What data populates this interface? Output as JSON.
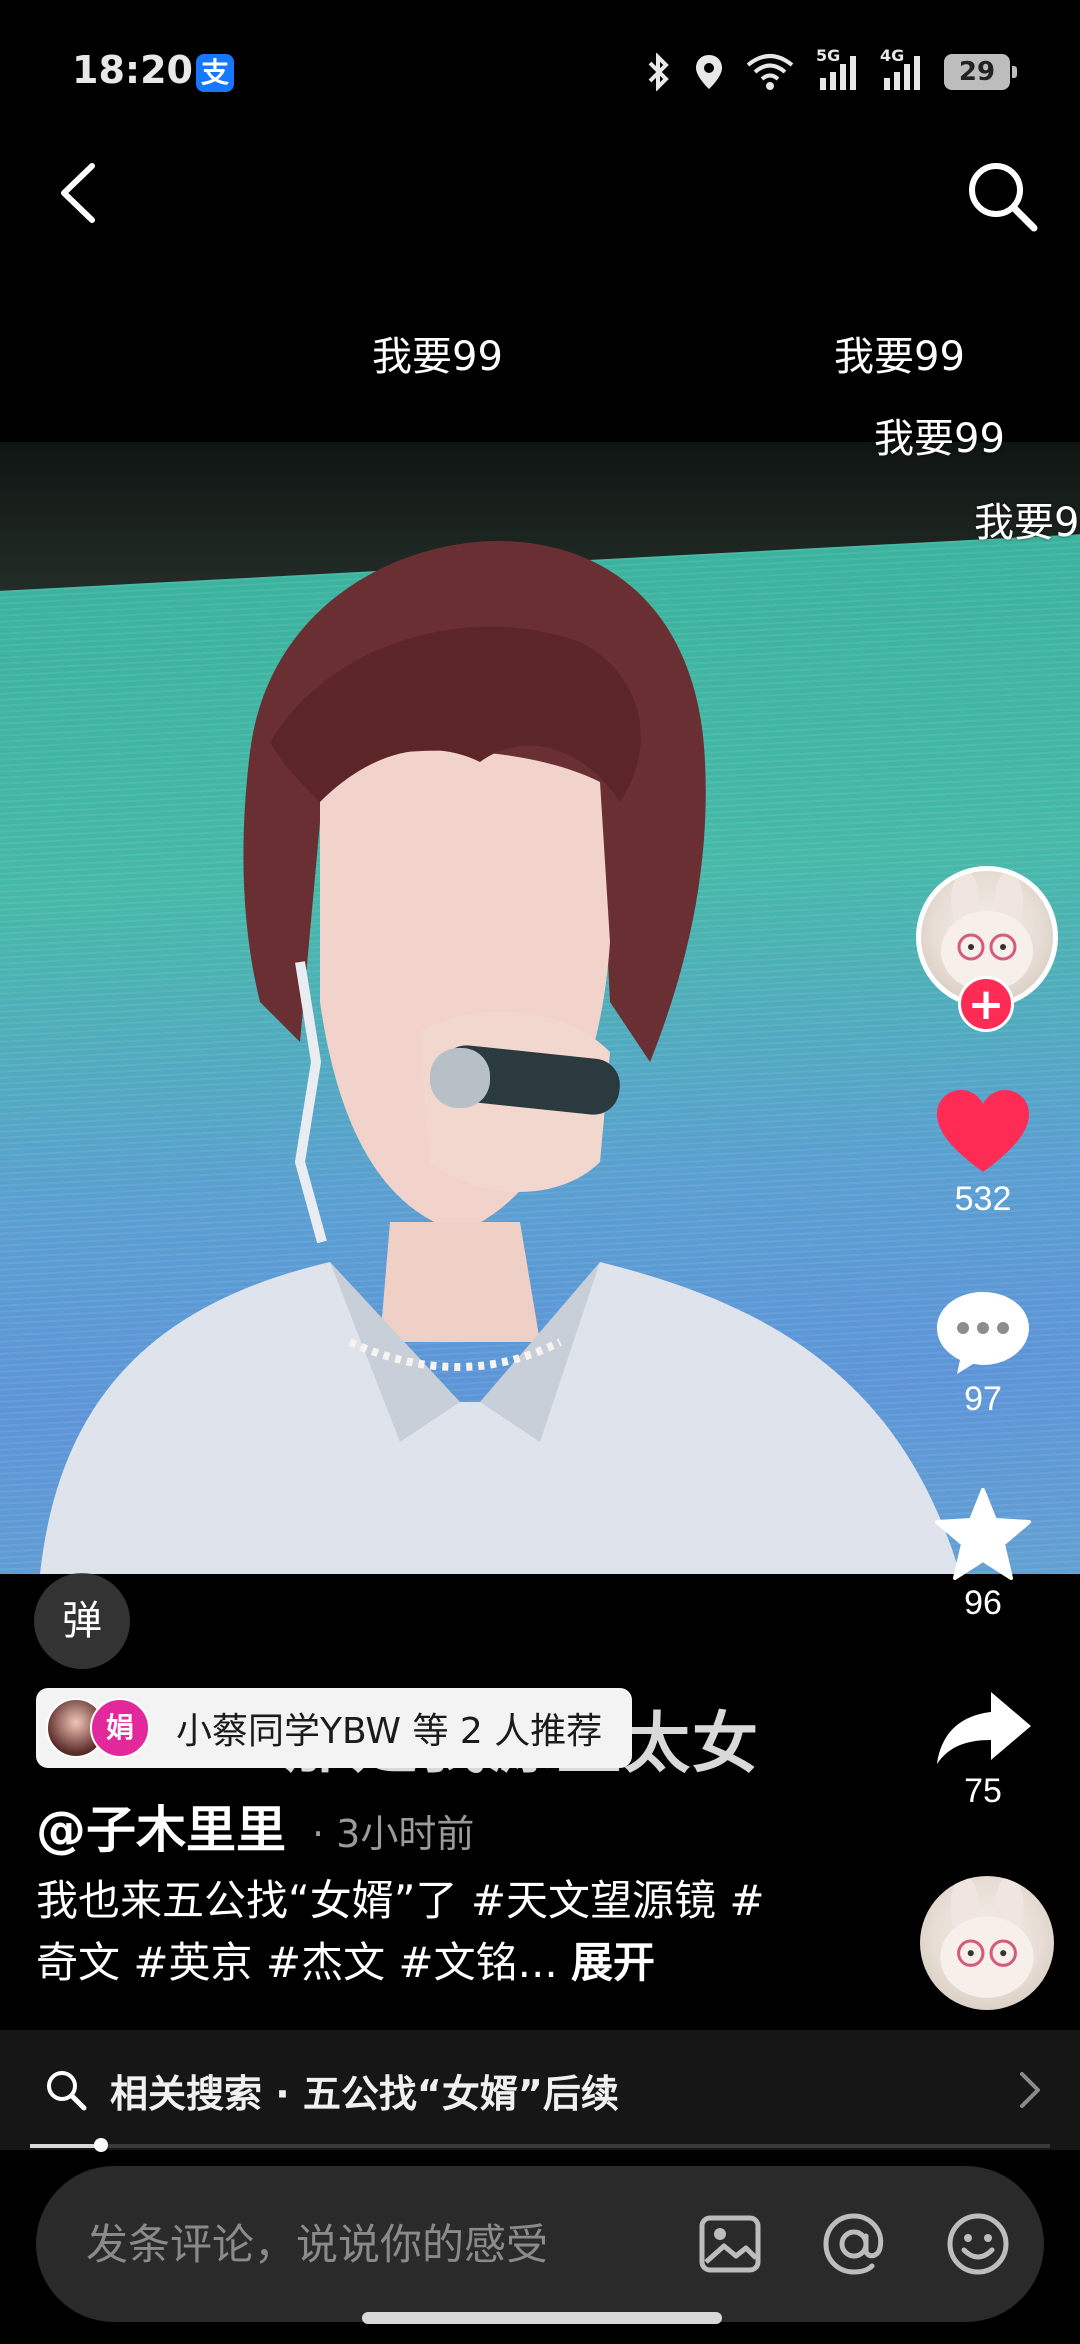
{
  "status_bar": {
    "time": "18:20",
    "app_icon": "alipay-icon",
    "app_icon_label": "支",
    "network_1": "5G",
    "network_2": "4G",
    "battery": "29"
  },
  "nav": {
    "back_icon": "chevron-left-icon",
    "search_icon": "search-icon"
  },
  "danmaku": [
    {
      "text": "我要99"
    },
    {
      "text": "我要99"
    },
    {
      "text": "我要99"
    },
    {
      "text": "我要9"
    }
  ],
  "side_actions": {
    "likes": "532",
    "comments": "97",
    "favorites": "96",
    "shares": "75",
    "colors": {
      "like": "#fe2c55",
      "follow": "#fe2c55"
    }
  },
  "danmu_toggle_label": "弹",
  "recommend": {
    "avatar_2_label": "娟",
    "text": "小蔡同学YBW 等 2 人推荐"
  },
  "video_subtitle": "那是我源皇太女",
  "author": {
    "name": "@子木里里",
    "time": "· 3小时前"
  },
  "caption": {
    "line1": "我也来五公找“女婿”了 #天文望源镜 #",
    "line2": "奇文 #英京 #杰文 #文铭...",
    "expand": "展开"
  },
  "related_search": {
    "text": "相关搜索 · 五公找“女婿”后续"
  },
  "progress": {
    "fraction": 0.07
  },
  "comment_bar": {
    "placeholder": "发条评论，说说你的感受"
  }
}
